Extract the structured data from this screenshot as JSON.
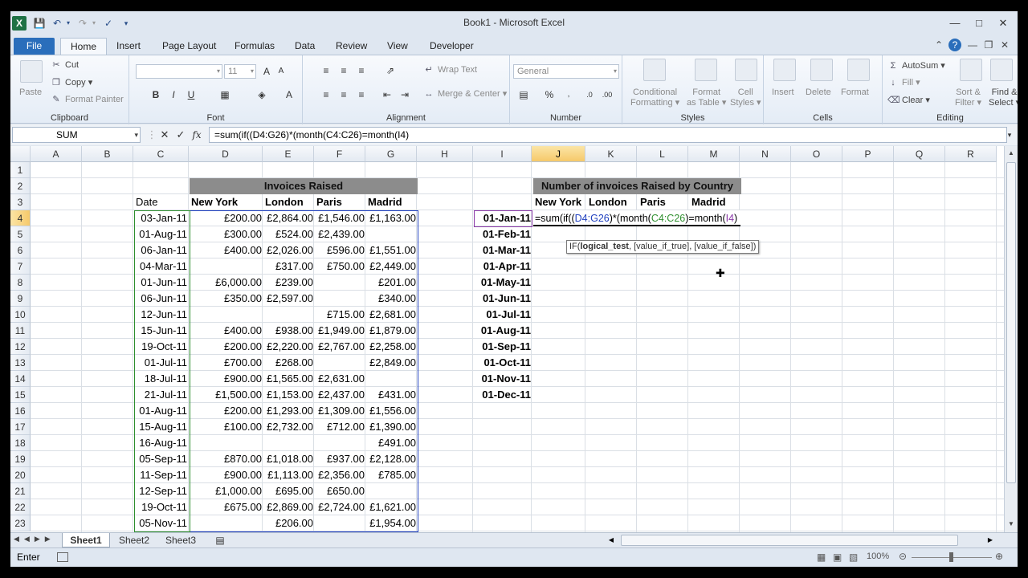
{
  "window": {
    "title": "Book1  -  Microsoft Excel"
  },
  "tabs": {
    "file": "File",
    "items": [
      "Home",
      "Insert",
      "Page Layout",
      "Formulas",
      "Data",
      "Review",
      "View",
      "Developer"
    ]
  },
  "ribbon": {
    "clipboard": {
      "paste": "Paste",
      "cut": "Cut",
      "copy": "Copy",
      "format_painter": "Format Painter",
      "label": "Clipboard"
    },
    "font": {
      "size": "11",
      "label": "Font"
    },
    "alignment": {
      "wrap_text": "Wrap Text",
      "merge_center": "Merge & Center",
      "label": "Alignment"
    },
    "number": {
      "format": "General",
      "label": "Number"
    },
    "styles": {
      "conditional_l1": "Conditional",
      "conditional_l2": "Formatting",
      "format_table_l1": "Format",
      "format_table_l2": "as Table",
      "cell_styles_l1": "Cell",
      "cell_styles_l2": "Styles",
      "label": "Styles"
    },
    "cells": {
      "insert": "Insert",
      "delete": "Delete",
      "format": "Format",
      "label": "Cells"
    },
    "editing": {
      "autosum": "AutoSum",
      "fill": "Fill",
      "clear": "Clear",
      "sort_l1": "Sort &",
      "sort_l2": "Filter",
      "find_l1": "Find &",
      "find_l2": "Select",
      "label": "Editing"
    }
  },
  "formula_bar": {
    "name_box": "SUM",
    "fx": "fx",
    "formula": "=sum(if((D4:G26)*(month(C4:C26)=month(I4)"
  },
  "columns": [
    "A",
    "B",
    "C",
    "D",
    "E",
    "F",
    "G",
    "H",
    "I",
    "J",
    "K",
    "L",
    "M",
    "N",
    "O",
    "P",
    "Q",
    "R"
  ],
  "rows": [
    "1",
    "2",
    "3",
    "4",
    "5",
    "6",
    "7",
    "8",
    "9",
    "10",
    "11",
    "12",
    "13",
    "14",
    "15",
    "16",
    "17",
    "18",
    "19",
    "20",
    "21",
    "22",
    "23"
  ],
  "sheet": {
    "invoices_title": "Invoices Raised",
    "headers": [
      "Date",
      "New York",
      "London",
      "Paris",
      "Madrid"
    ],
    "data": [
      [
        "03-Jan-11",
        "£200.00",
        "£2,864.00",
        "£1,546.00",
        "£1,163.00"
      ],
      [
        "01-Aug-11",
        "£300.00",
        "£524.00",
        "£2,439.00",
        ""
      ],
      [
        "06-Jan-11",
        "£400.00",
        "£2,026.00",
        "£596.00",
        "£1,551.00"
      ],
      [
        "04-Mar-11",
        "",
        "£317.00",
        "£750.00",
        "£2,449.00"
      ],
      [
        "01-Jun-11",
        "£6,000.00",
        "£239.00",
        "",
        "£201.00"
      ],
      [
        "06-Jun-11",
        "£350.00",
        "£2,597.00",
        "",
        "£340.00"
      ],
      [
        "12-Jun-11",
        "",
        "",
        "£715.00",
        "£2,681.00"
      ],
      [
        "15-Jun-11",
        "£400.00",
        "£938.00",
        "£1,949.00",
        "£1,879.00"
      ],
      [
        "19-Oct-11",
        "£200.00",
        "£2,220.00",
        "£2,767.00",
        "£2,258.00"
      ],
      [
        "01-Jul-11",
        "£700.00",
        "£268.00",
        "",
        "£2,849.00"
      ],
      [
        "18-Jul-11",
        "£900.00",
        "£1,565.00",
        "£2,631.00",
        ""
      ],
      [
        "21-Jul-11",
        "£1,500.00",
        "£1,153.00",
        "£2,437.00",
        "£431.00"
      ],
      [
        "01-Aug-11",
        "£200.00",
        "£1,293.00",
        "£1,309.00",
        "£1,556.00"
      ],
      [
        "15-Aug-11",
        "£100.00",
        "£2,732.00",
        "£712.00",
        "£1,390.00"
      ],
      [
        "16-Aug-11",
        "",
        "",
        "",
        "£491.00"
      ],
      [
        "05-Sep-11",
        "£870.00",
        "£1,018.00",
        "£937.00",
        "£2,128.00"
      ],
      [
        "11-Sep-11",
        "£900.00",
        "£1,113.00",
        "£2,356.00",
        "£785.00"
      ],
      [
        "12-Sep-11",
        "£1,000.00",
        "£695.00",
        "£650.00",
        ""
      ],
      [
        "19-Oct-11",
        "£675.00",
        "£2,869.00",
        "£2,724.00",
        "£1,621.00"
      ],
      [
        "05-Nov-11",
        "",
        "£206.00",
        "",
        "£1,954.00"
      ]
    ],
    "summary_title": "Number of invoices Raised by Country",
    "summary_headers": [
      "New York",
      "London",
      "Paris",
      "Madrid"
    ],
    "months": [
      "01-Jan-11",
      "01-Feb-11",
      "01-Mar-11",
      "01-Apr-11",
      "01-May-11",
      "01-Jun-11",
      "01-Jul-11",
      "01-Aug-11",
      "01-Sep-11",
      "01-Oct-11",
      "01-Nov-11",
      "01-Dec-11"
    ],
    "editing_formula": {
      "p1": "=sum(if((",
      "p2": "D4:G26",
      "p3": ")*(month(",
      "p4": "C4:C26",
      "p5": ")=month(",
      "p6": "I4",
      "p7": ")"
    },
    "tooltip": {
      "p1": "IF(",
      "p2": "logical_test",
      "p3": ", [value_if_true], [value_if_false])"
    }
  },
  "sheet_tabs": [
    "Sheet1",
    "Sheet2",
    "Sheet3"
  ],
  "status": {
    "mode": "Enter",
    "zoom": "100%"
  }
}
